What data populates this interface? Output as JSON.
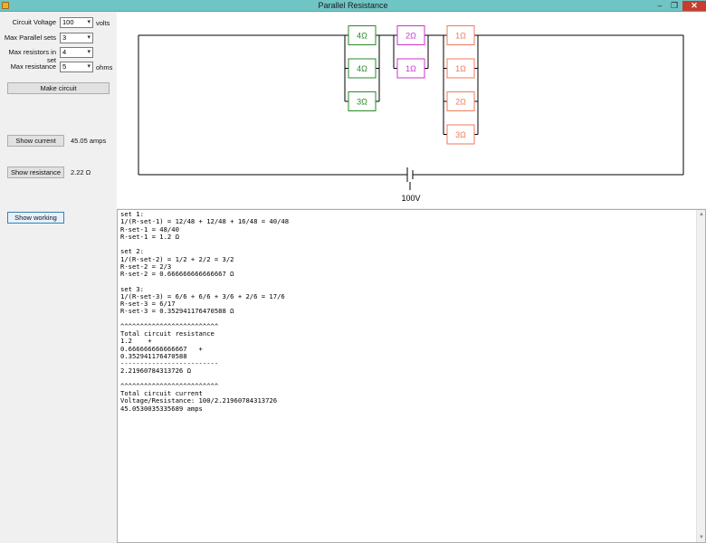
{
  "window": {
    "title": "Parallel Resistance",
    "minimize": "–",
    "restore": "❐",
    "close": "✕"
  },
  "controls": {
    "circuit_voltage": {
      "label": "Circuit Voltage",
      "value": "100",
      "unit": "volts"
    },
    "max_parallel_sets": {
      "label": "Max Parallel sets",
      "value": "3"
    },
    "max_resistors": {
      "label": "Max resistors in set",
      "value": "4"
    },
    "max_resistance": {
      "label": "Max resistance",
      "value": "5",
      "unit": "ohms"
    },
    "make_circuit": "Make circuit",
    "show_current": {
      "label": "Show current",
      "value": "45.05 amps"
    },
    "show_resistance": {
      "label": "Show resistance",
      "value": "2.22 Ω"
    },
    "show_working": "Show working"
  },
  "circuit": {
    "battery_label": "100V",
    "sets": [
      {
        "color": "#2a8a2a",
        "resistors": [
          "4Ω",
          "4Ω",
          "3Ω"
        ]
      },
      {
        "color": "#cc33cc",
        "resistors": [
          "2Ω",
          "1Ω"
        ]
      },
      {
        "color": "#f07a5a",
        "resistors": [
          "1Ω",
          "1Ω",
          "2Ω",
          "3Ω"
        ]
      }
    ]
  },
  "working_text": "set 1:\n1/(R-set-1) = 12/48 + 12/48 + 16/48 = 40/48\nR-set-1 = 48/40\nR-set-1 = 1.2 Ω\n\nset 2:\n1/(R-set-2) = 1/2 + 2/2 = 3/2\nR-set-2 = 2/3\nR-set-2 = 0.666666666666667 Ω\n\nset 3:\n1/(R-set-3) = 6/6 + 6/6 + 3/6 + 2/6 = 17/6\nR-set-3 = 6/17\nR-set-3 = 0.352941176470588 Ω\n\n^^^^^^^^^^^^^^^^^^^^^^^^^\nTotal circuit resistance\n1.2    +\n0.666666666666667   +\n0.352941176470588\n-------------------------\n2.21960784313726 Ω\n\n^^^^^^^^^^^^^^^^^^^^^^^^^\nTotal circuit current\nVoltage/Resistance: 100/2.21960784313726\n45.0530035335689 amps"
}
